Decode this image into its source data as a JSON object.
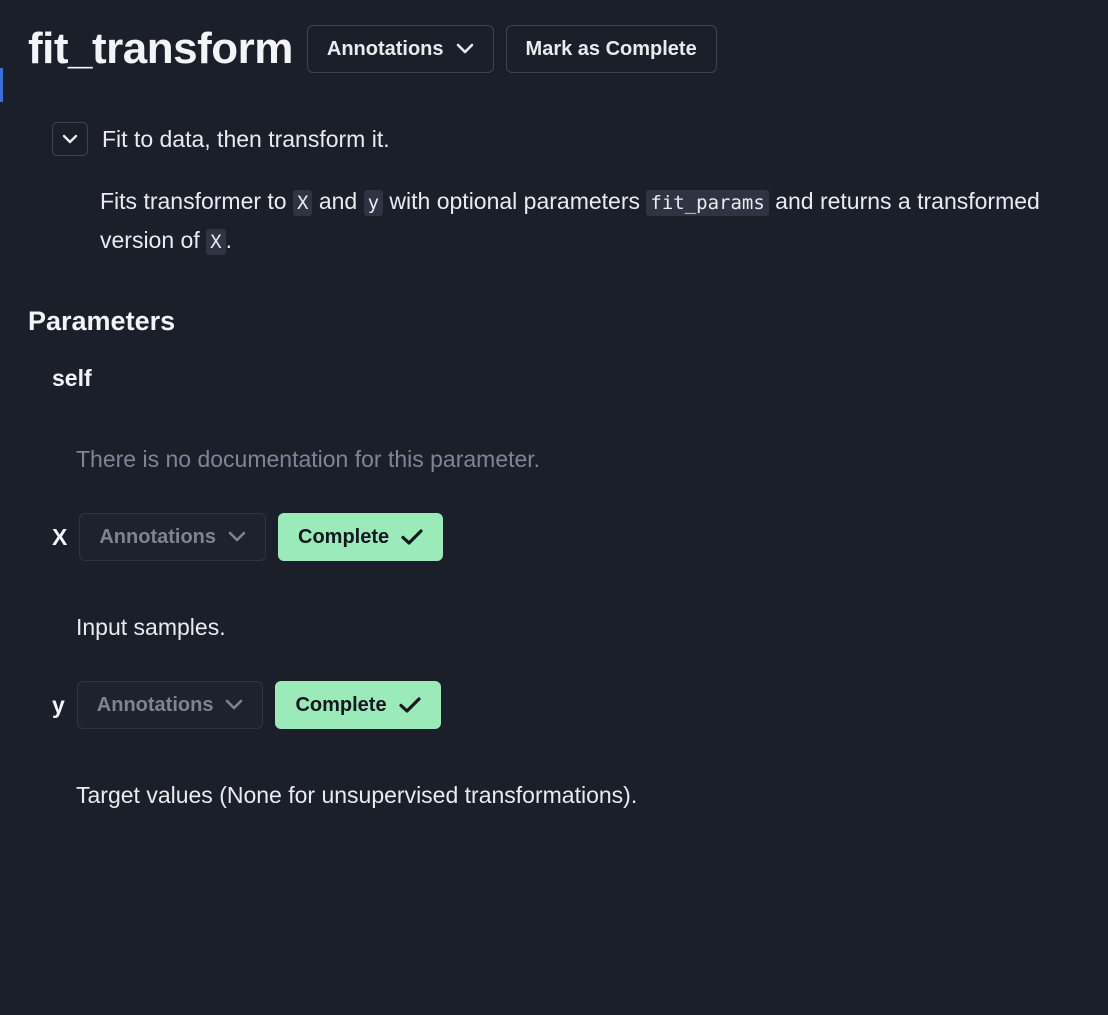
{
  "header": {
    "title": "fit_transform",
    "annotations_label": "Annotations",
    "mark_complete_label": "Mark as Complete"
  },
  "summary": {
    "text": "Fit to data, then transform it."
  },
  "description": {
    "part1": "Fits transformer to ",
    "code1": "X",
    "part2": " and ",
    "code2": "y",
    "part3": " with optional parameters ",
    "code3": "fit_params",
    "part4": " and returns a transformed version of ",
    "code4": "X",
    "part5": "."
  },
  "parameters": {
    "section_title": "Parameters",
    "items": [
      {
        "name": "self",
        "doc": "There is no documentation for this parameter."
      },
      {
        "name": "X",
        "annotations_label": "Annotations",
        "complete_label": "Complete",
        "doc": "Input samples."
      },
      {
        "name": "y",
        "annotations_label": "Annotations",
        "complete_label": "Complete",
        "doc": "Target values (None for unsupervised transformations)."
      }
    ]
  },
  "colors": {
    "background": "#1b1f2a",
    "complete_button": "#9aeaba",
    "muted_text": "#7c8696",
    "code_background": "#2f3442"
  }
}
